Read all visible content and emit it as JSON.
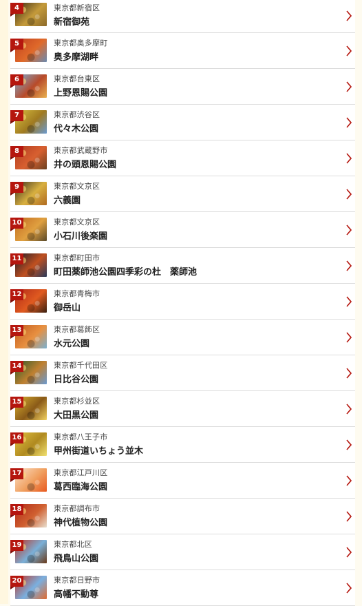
{
  "spots": [
    {
      "rank": "4",
      "location": "東京都新宿区",
      "name": "新宿御苑",
      "colors": [
        "#3a2a14",
        "#c49a3a",
        "#8c6a2a"
      ]
    },
    {
      "rank": "5",
      "location": "東京都奥多摩町",
      "name": "奥多摩湖畔",
      "colors": [
        "#c04020",
        "#e06a2a",
        "#6a8ab0"
      ]
    },
    {
      "rank": "6",
      "location": "東京都台東区",
      "name": "上野恩賜公園",
      "colors": [
        "#7ab0d8",
        "#b84a2a",
        "#e8b050"
      ]
    },
    {
      "rank": "7",
      "location": "東京都渋谷区",
      "name": "代々木公園",
      "colors": [
        "#d8c040",
        "#a07a20",
        "#6a9ad0"
      ]
    },
    {
      "rank": "8",
      "location": "東京都武蔵野市",
      "name": "井の頭恩賜公園",
      "colors": [
        "#b03a20",
        "#d86030",
        "#6a4020"
      ]
    },
    {
      "rank": "9",
      "location": "東京都文京区",
      "name": "六義園",
      "colors": [
        "#3a3020",
        "#d8b040",
        "#b06a20"
      ]
    },
    {
      "rank": "10",
      "location": "東京都文京区",
      "name": "小石川後楽園",
      "colors": [
        "#c06a20",
        "#e0a040",
        "#5a4a2a"
      ]
    },
    {
      "rank": "11",
      "location": "東京都町田市",
      "name": "町田薬師池公園四季彩の杜　薬師池",
      "colors": [
        "#1a1a2a",
        "#c05020",
        "#2a3a5a"
      ]
    },
    {
      "rank": "12",
      "location": "東京都青梅市",
      "name": "御岳山",
      "colors": [
        "#b02a18",
        "#e05a20",
        "#3a2010"
      ]
    },
    {
      "rank": "13",
      "location": "東京都葛飾区",
      "name": "水元公園",
      "colors": [
        "#c05a20",
        "#e89040",
        "#7ab0d0"
      ]
    },
    {
      "rank": "14",
      "location": "東京都千代田区",
      "name": "日比谷公園",
      "colors": [
        "#2a5a2a",
        "#c08030",
        "#6a9ad0"
      ]
    },
    {
      "rank": "15",
      "location": "東京都杉並区",
      "name": "大田黒公園",
      "colors": [
        "#d8b030",
        "#8a5a18",
        "#f0d060"
      ]
    },
    {
      "rank": "16",
      "location": "東京都八王子市",
      "name": "甲州街道いちょう並木",
      "colors": [
        "#e0c040",
        "#b08a20",
        "#f0e070"
      ]
    },
    {
      "rank": "17",
      "location": "東京都江戸川区",
      "name": "葛西臨海公園",
      "colors": [
        "#fbe0c8",
        "#f0a060",
        "#e85a20"
      ]
    },
    {
      "rank": "18",
      "location": "東京都調布市",
      "name": "神代植物公園",
      "colors": [
        "#b02a18",
        "#d06030",
        "#e8e0d0"
      ]
    },
    {
      "rank": "19",
      "location": "東京都北区",
      "name": "飛鳥山公園",
      "colors": [
        "#c03020",
        "#7ab0d8",
        "#6a3a1a"
      ]
    },
    {
      "rank": "20",
      "location": "東京都日野市",
      "name": "高幡不動尊",
      "colors": [
        "#c03020",
        "#7ab0e0",
        "#e06a30"
      ]
    }
  ],
  "accent": "#b5160e",
  "chevron_icon": "chevron-right-icon"
}
